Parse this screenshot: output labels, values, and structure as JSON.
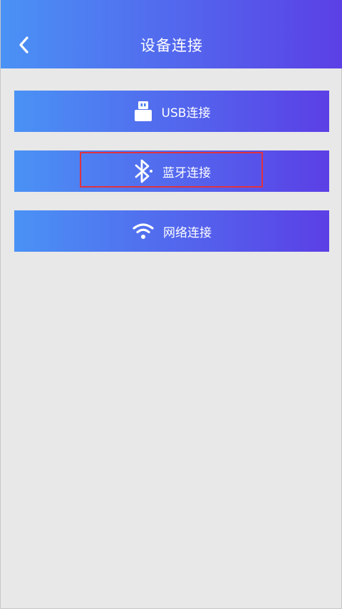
{
  "header": {
    "title": "设备连接",
    "back_icon": "chevron-left-icon"
  },
  "connections": [
    {
      "label": "USB连接",
      "icon": "usb-icon"
    },
    {
      "label": "蓝牙连接",
      "icon": "bluetooth-icon",
      "highlighted": true
    },
    {
      "label": "网络连接",
      "icon": "wifi-icon"
    }
  ],
  "colors": {
    "gradient_start": "#4a92f5",
    "gradient_end": "#5b3fe6",
    "background": "#e8e8e8",
    "highlight_border": "#e0323e",
    "text": "#ffffff"
  }
}
